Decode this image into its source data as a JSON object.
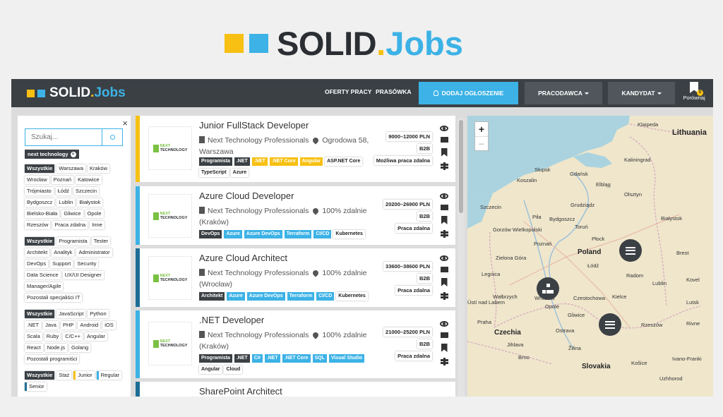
{
  "brand": {
    "part1": "SOLID",
    "part2": ".",
    "part3": "Jobs"
  },
  "nav": {
    "offers": "OFERTY PRACY",
    "press": "PRASÓWKA",
    "add_ad": "DODAJ OGŁOSZENIE",
    "employer": "PRACODAWCA",
    "candidate": "KANDYDAT",
    "compare": "Porównaj",
    "compare_count": "0"
  },
  "filters": {
    "close": "×",
    "search_placeholder": "Szukaj...",
    "active": "next technology",
    "cities": [
      "Wszystkie",
      "Warszawa",
      "Kraków",
      "Wrocław",
      "Poznań",
      "Katowice",
      "Trójmiasto",
      "Łódź",
      "Szczecin",
      "Bydgoszcz",
      "Lublin",
      "Białystok",
      "Bielsko-Biała",
      "Gliwice",
      "Opole",
      "Rzeszów",
      "Praca zdalna",
      "Inne"
    ],
    "roles": [
      "Wszystkie",
      "Programista",
      "Tester",
      "Architekt",
      "Analityk",
      "Administrator",
      "DevOps",
      "Support",
      "Security",
      "Data Science",
      "UX/UI Designer",
      "Manager/Agile",
      "Pozostali specjaliści IT"
    ],
    "techs": [
      "Wszystkie",
      "JavaScript",
      "Python",
      ".NET",
      "Java",
      "PHP",
      "Android",
      "iOS",
      "Scala",
      "Ruby",
      "C/C++",
      "Angular",
      "React",
      "Node.js",
      "Golang",
      "Pozostali programiści"
    ],
    "levels": [
      "Wszystkie",
      "Staż",
      "Junior",
      "Regular",
      "Senior"
    ]
  },
  "jobs": [
    {
      "title": "Junior FullStack Developer",
      "company": "Next Technology Professionals",
      "location": "Ogrodowa 58, Warszawa",
      "salary": "9000–12000 PLN",
      "contract": "B2B",
      "remote": "Możliwa praca zdalna",
      "tags": [
        "Programista",
        ".NET",
        ".NET",
        ".NET Core",
        "Angular",
        "ASP.NET Core",
        "TypeScript",
        "Azure"
      ]
    },
    {
      "title": "Azure Cloud Developer",
      "company": "Next Technology Professionals",
      "location": "100% zdalnie (Kraków)",
      "salary": "20200–26900 PLN",
      "contract": "B2B",
      "remote": "Praca zdalna",
      "tags": [
        "DevOps",
        "Azure",
        "Azure DevOps",
        "Terraform",
        "CI/CD",
        "Kubernetes"
      ]
    },
    {
      "title": "Azure Cloud Architect",
      "company": "Next Technology Professionals",
      "location": "100% zdalnie (Wrocław)",
      "salary": "33600–38600 PLN",
      "contract": "B2B",
      "remote": "Praca zdalna",
      "tags": [
        "Architekt",
        "Azure",
        "Azure DevOps",
        "Terraform",
        "CI/CD",
        "Kubernetes"
      ]
    },
    {
      "title": ".NET Developer",
      "company": "Next Technology Professionals",
      "location": "100% zdalnie (Kraków)",
      "salary": "21000–25200 PLN",
      "contract": "B2B",
      "remote": "Praca zdalna",
      "tags": [
        "Programista",
        ".NET",
        "C#",
        ".NET",
        ".NET Core",
        "SQL",
        "Visual Studio",
        "Angular",
        "Cloud"
      ]
    },
    {
      "title": "SharePoint Architect"
    }
  ],
  "logo_text": {
    "n": "NEXT",
    "t": "TECHNOLOGY",
    "s": "PROFESSIONALS"
  },
  "map": {
    "zoom_in": "+",
    "zoom_out": "−",
    "labels": {
      "lithuania": "Lithuania",
      "klaipeda": "Klaipeda",
      "kaliningrad": "Kaliningrad",
      "slupsk": "Słupsk",
      "gdansk": "Gdańsk",
      "koszalin": "Koszalin",
      "elblag": "Elbląg",
      "olsztyn": "Olsztyn",
      "szczecin": "Szczecin",
      "grudziadz": "Grudziądz",
      "pila": "Piła",
      "bydgoszcz": "Bydgoszcz",
      "bialystok": "Białystok",
      "torun": "Toruń",
      "gorzow": "Gorzów Wielkopolski",
      "plock": "Płock",
      "poznan": "Poznań",
      "poland": "Poland",
      "brest": "Brest",
      "zielona": "Zielona Góra",
      "lodz": "Łódź",
      "radom": "Radom",
      "lublin": "Lublin",
      "wroclaw": "Wrocław",
      "czestochowa": "Czestochowa",
      "kielce": "Kielce",
      "legnica": "Legnica",
      "walbrzych": "Wałbrzych",
      "opole": "Opole",
      "gliwice": "Gliwice",
      "rzeszow": "Rzeszów",
      "usti": "Ústí nad Labem",
      "praha": "Praha",
      "czechia": "Czechia",
      "jihlava": "Jihlava",
      "ostrava": "Ostrava",
      "brno": "Brno",
      "kosice": "Košice",
      "slovakia": "Slovakia",
      "zilina": "Žilina",
      "uzhhorod": "Uzhhorod",
      "kovel": "Kovel",
      "lutsk": "Lutsk",
      "rivne": "Rivne",
      "ivano": "Ivano-Franki"
    }
  },
  "colors": {
    "yellow": "#f7c012",
    "blue": "#3cb2e6",
    "dark_blue": "#1e6f96",
    "dark": "#3b4045"
  }
}
